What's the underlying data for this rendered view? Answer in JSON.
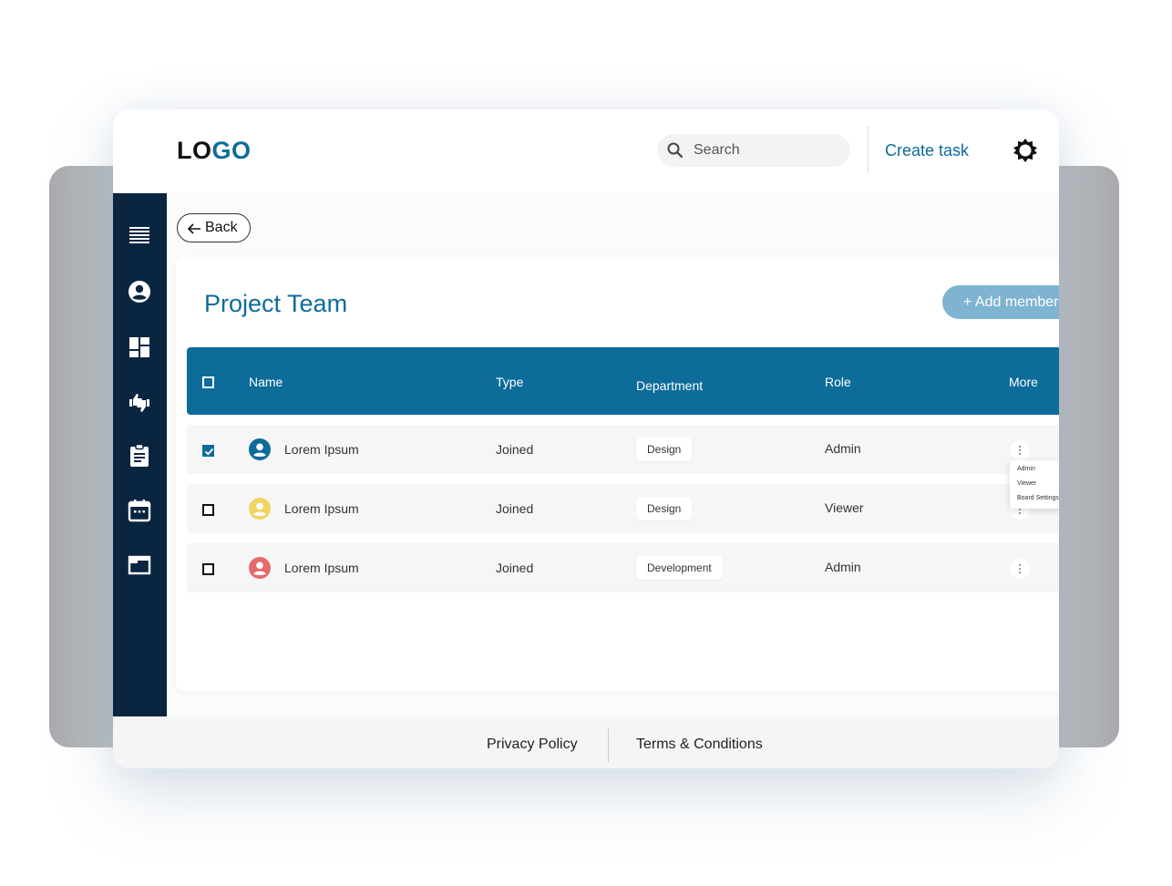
{
  "header": {
    "logo_left": "LO",
    "logo_right": "GO",
    "search_placeholder": "Search",
    "create_task": "Create task"
  },
  "sidebar": {
    "items": [
      {
        "icon": "menu-icon"
      },
      {
        "icon": "account-circle-icon"
      },
      {
        "icon": "dashboard-icon"
      },
      {
        "icon": "thumbs-up-down-icon"
      },
      {
        "icon": "clipboard-icon"
      },
      {
        "icon": "calendar-icon"
      },
      {
        "icon": "window-icon"
      }
    ]
  },
  "main": {
    "back_label": "Back",
    "title": "Project Team",
    "add_member": "+ Add member"
  },
  "table": {
    "columns": [
      "Name",
      "Type",
      "Department",
      "Role",
      "More"
    ],
    "rows": [
      {
        "checked": true,
        "avatar_color": "#0d6c9a",
        "name": "Lorem Ipsum",
        "type": "Joined",
        "department": "Design",
        "role": "Admin"
      },
      {
        "checked": false,
        "avatar_color": "#f0d565",
        "name": "Lorem Ipsum",
        "type": "Joined",
        "department": "Design",
        "role": "Viewer"
      },
      {
        "checked": false,
        "avatar_color": "#e86a6a",
        "name": "Lorem Ipsum",
        "type": "Joined",
        "department": "Development",
        "role": "Admin"
      }
    ],
    "more_menu": [
      "Admin",
      "Viewer",
      "Board Settings"
    ]
  },
  "footer": {
    "privacy": "Privacy Policy",
    "terms": "Terms & Conditions"
  },
  "colors": {
    "accent": "#0d6c9a",
    "sidebar": "#0a2540",
    "button_disabled": "#7fb4d0"
  }
}
